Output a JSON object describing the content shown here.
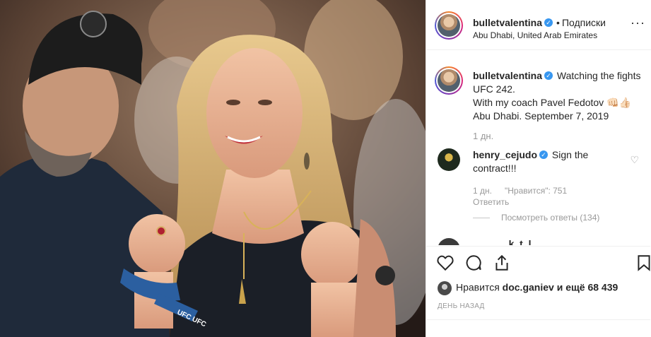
{
  "post": {
    "username": "bulletvalentina",
    "follow_label": "Подписки",
    "separator": "•",
    "location": "Abu Dhabi, United Arab Emirates",
    "more_label": "···"
  },
  "caption": {
    "username": "bulletvalentina",
    "lines": [
      "Watching the fights",
      "UFC 242.",
      "With my coach Pavel Fedotov 👊🏻👍🏻",
      "Abu Dhabi. September 7, 2019"
    ],
    "time": "1 дн."
  },
  "comment": {
    "username": "henry_cejudo",
    "text": "Sign the contract!!!",
    "time": "1 дн.",
    "likes": "\"Нравится\": 751",
    "reply_label": "Ответить",
    "view_replies": "Посмотреть ответы (134)"
  },
  "next_comment_partial": "___ ___k_t_l ___ ___",
  "engagement": {
    "liked_by_prefix": "Нравится",
    "liked_by_user": "doc.ganiev",
    "liked_by_suffix": "и ещё 68 439",
    "date_label": "ДЕНЬ НАЗАД"
  },
  "photo": {
    "wristband_text": "UFC UFC"
  },
  "colors": {
    "verified": "#3897f0",
    "muted": "#999999",
    "border": "#efefef"
  }
}
